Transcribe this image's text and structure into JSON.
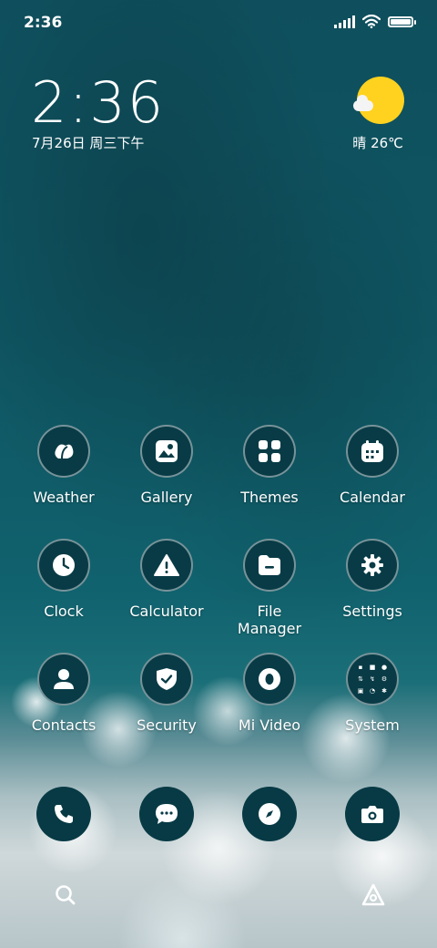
{
  "status_bar": {
    "time": "2:36",
    "icons": [
      "signal-icon",
      "wifi-icon",
      "battery-icon"
    ],
    "battery_level": 0.95
  },
  "clock_widget": {
    "time": "2:36",
    "date": "7月26日 周三下午"
  },
  "weather_widget": {
    "condition_icon": "sun-cloud-icon",
    "text": "晴 26℃",
    "sun_color": "#ffd21f"
  },
  "apps": [
    {
      "label": "Weather",
      "icon": "weather-icon"
    },
    {
      "label": "Gallery",
      "icon": "gallery-icon"
    },
    {
      "label": "Themes",
      "icon": "themes-icon"
    },
    {
      "label": "Calendar",
      "icon": "calendar-icon"
    },
    {
      "label": "Clock",
      "icon": "clock-icon"
    },
    {
      "label": "Calculator",
      "icon": "calculator-icon"
    },
    {
      "label": "File Manager",
      "icon": "file-manager-icon"
    },
    {
      "label": "Settings",
      "icon": "settings-icon"
    },
    {
      "label": "Contacts",
      "icon": "contacts-icon"
    },
    {
      "label": "Security",
      "icon": "security-icon"
    },
    {
      "label": "Mi Video",
      "icon": "mi-video-icon"
    },
    {
      "label": "System",
      "icon": "system-folder-icon"
    }
  ],
  "dock": [
    {
      "icon": "phone-icon"
    },
    {
      "icon": "messages-icon"
    },
    {
      "icon": "browser-icon"
    },
    {
      "icon": "camera-icon"
    }
  ],
  "bottom_bar": {
    "left_icon": "search-icon",
    "right_icon": "app-vault-icon"
  },
  "colors": {
    "icon_bg": "#083b46",
    "ocean": "#0f4f5d"
  }
}
